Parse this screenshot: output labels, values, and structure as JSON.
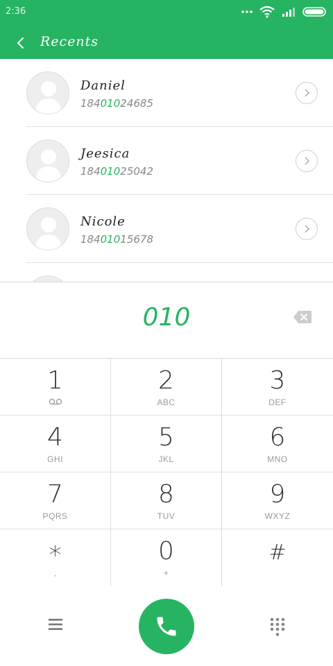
{
  "status_bar": {
    "time": "2:36"
  },
  "header": {
    "title": "Recents"
  },
  "recents": [
    {
      "name": "Daniel",
      "number_prefix": "184",
      "number_match": "010",
      "number_suffix": "24685"
    },
    {
      "name": "Jeesica",
      "number_prefix": "184",
      "number_match": "010",
      "number_suffix": "25042"
    },
    {
      "name": "Nicole",
      "number_prefix": "184",
      "number_match": "010",
      "number_suffix": "15678"
    }
  ],
  "dialer": {
    "input": "010"
  },
  "keypad": {
    "keys": [
      {
        "digit": "1",
        "letters": ""
      },
      {
        "digit": "2",
        "letters": "ABC"
      },
      {
        "digit": "3",
        "letters": "DEF"
      },
      {
        "digit": "4",
        "letters": "GHI"
      },
      {
        "digit": "5",
        "letters": "JKL"
      },
      {
        "digit": "6",
        "letters": "MNO"
      },
      {
        "digit": "7",
        "letters": "PQRS"
      },
      {
        "digit": "8",
        "letters": "TUV"
      },
      {
        "digit": "9",
        "letters": "WXYZ"
      },
      {
        "digit": "*",
        "letters": ","
      },
      {
        "digit": "0",
        "letters": "+"
      },
      {
        "digit": "#",
        "letters": ""
      }
    ]
  },
  "icons": {
    "back": "chevron-left-icon",
    "voicemail": "voicemail-icon",
    "backspace": "backspace-icon",
    "menu": "menu-icon",
    "call": "phone-icon",
    "keypad_toggle": "dialpad-icon"
  },
  "colors": {
    "accent": "#27b462",
    "text": "#333333",
    "muted": "#999999"
  }
}
